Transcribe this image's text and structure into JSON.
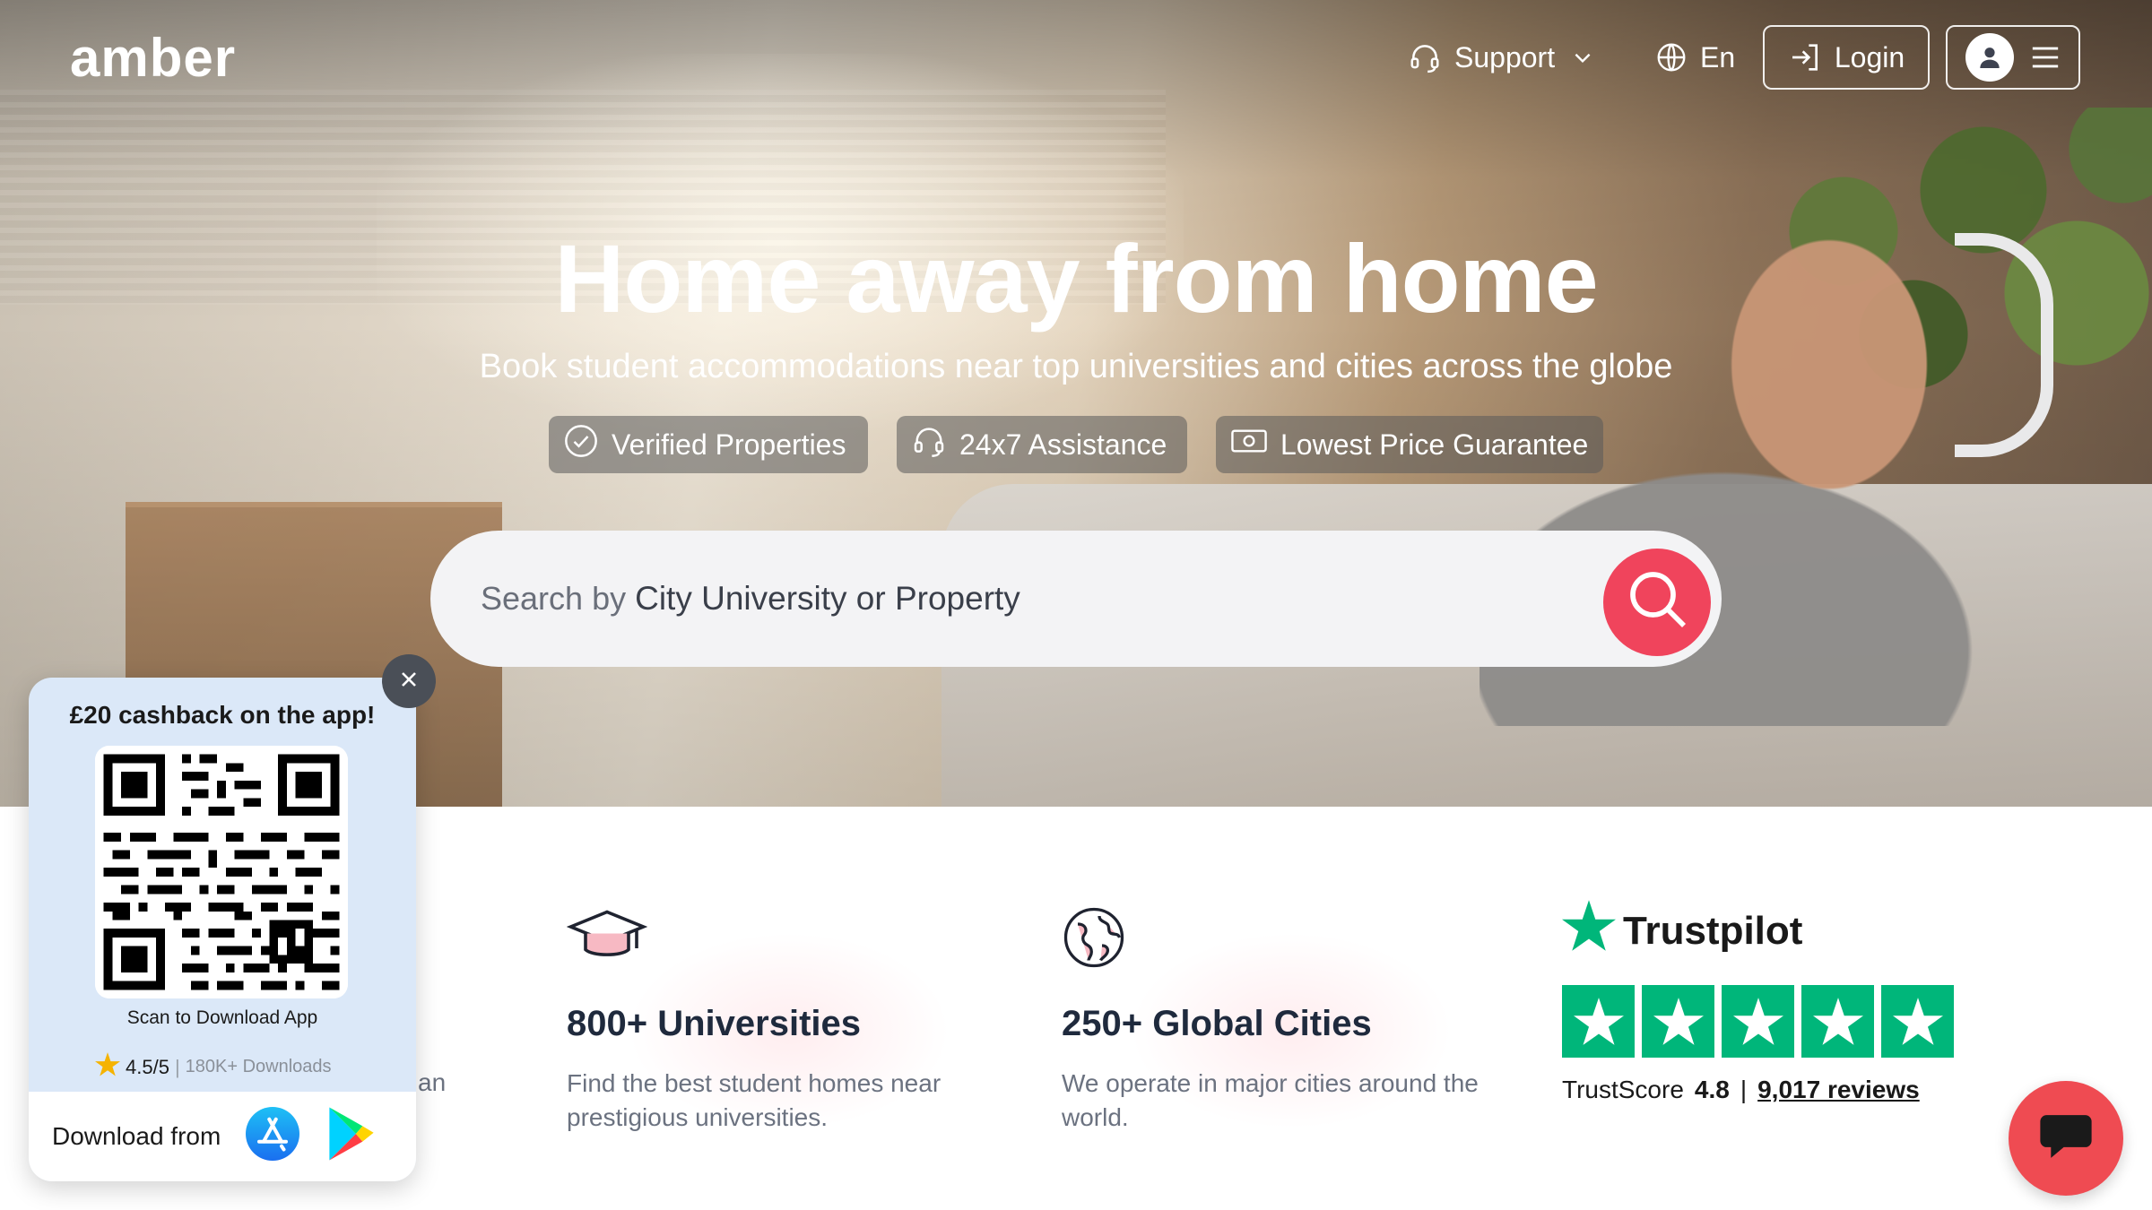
{
  "brand": {
    "logo_text": "amber",
    "accent": "#f0445c"
  },
  "nav": {
    "support_label": "Support",
    "language_label": "En",
    "login_label": "Login"
  },
  "hero": {
    "title": "Home away from home",
    "subtitle": "Book student accommodations near top universities and cities across the globe",
    "badges": [
      {
        "label": "Verified Properties",
        "icon": "check-circle-icon"
      },
      {
        "label": "24x7 Assistance",
        "icon": "headset-icon"
      },
      {
        "label": "Lowest Price Guarantee",
        "icon": "cash-icon"
      }
    ]
  },
  "search": {
    "prefix": "Search by",
    "placeholder": "City University or Property"
  },
  "stats": [
    {
      "title": "800+ Universities",
      "desc": "Find the best student homes near prestigious universities.",
      "icon": "graduation-cap-icon"
    },
    {
      "title": "250+ Global Cities",
      "desc": "We operate in major cities around the world.",
      "icon": "globe-icon"
    }
  ],
  "partial_text": "an",
  "trustpilot": {
    "brand": "Trustpilot",
    "score_label": "TrustScore",
    "score": "4.8",
    "separator": "|",
    "reviews": "9,017 reviews",
    "stars": 5,
    "color": "#00b67a"
  },
  "app_promo": {
    "title": "£20 cashback on the app!",
    "scan_label": "Scan to Download App",
    "rating": "4.5/5",
    "separator": "|",
    "downloads": "180K+ Downloads",
    "download_label": "Download from"
  }
}
